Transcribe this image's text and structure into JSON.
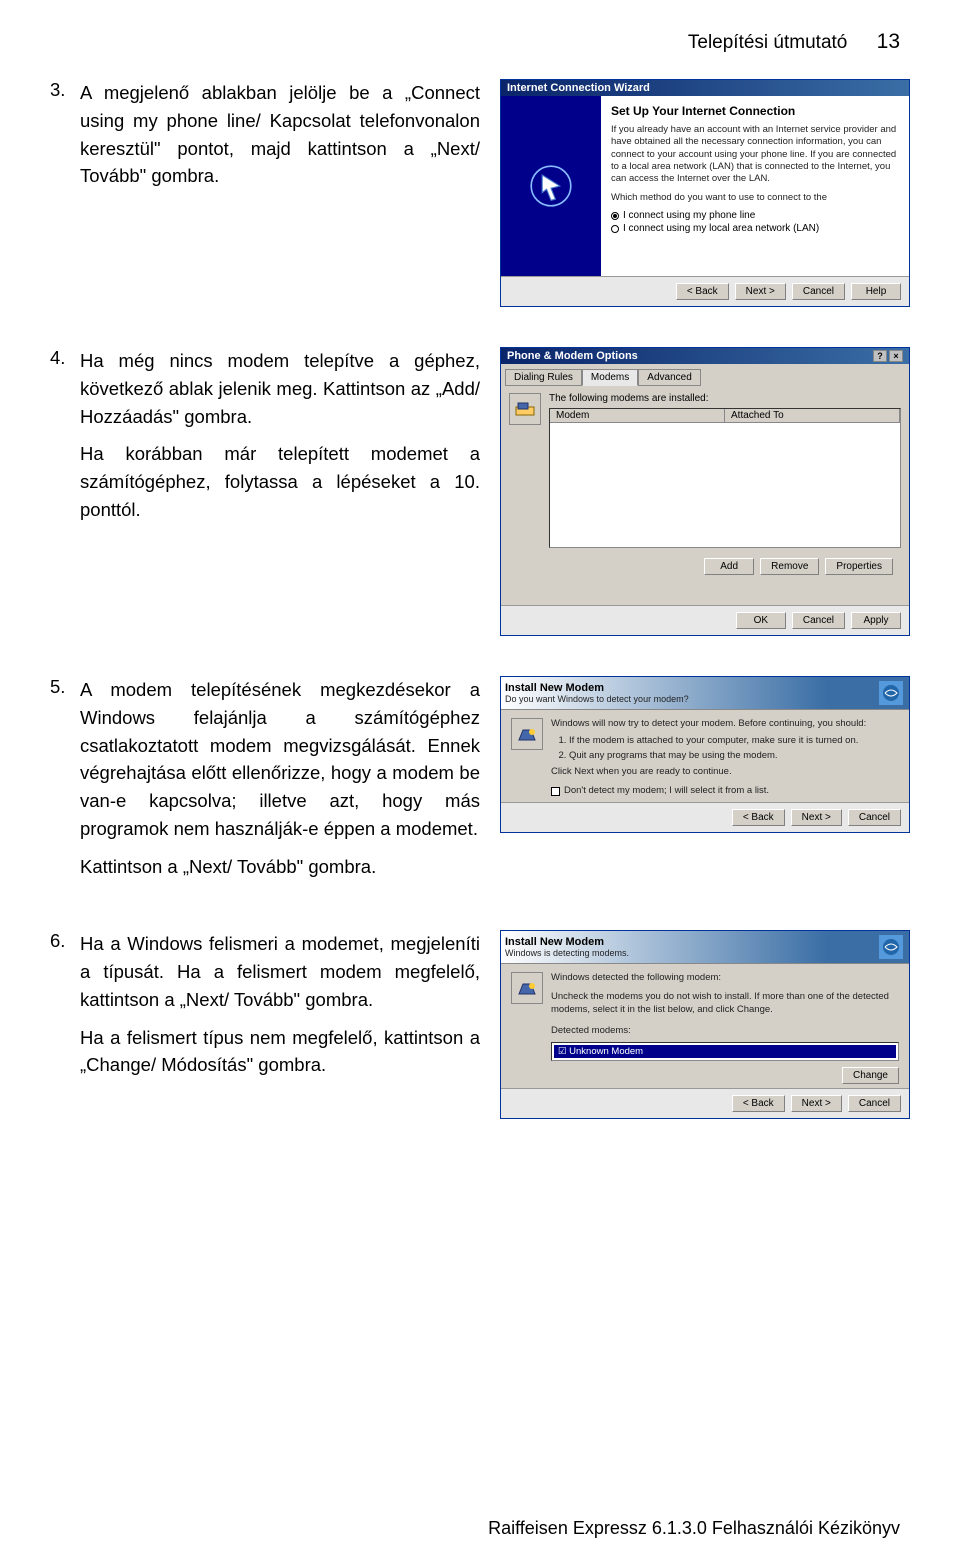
{
  "header": {
    "title": "Telepítési útmutató",
    "page": "13"
  },
  "steps": {
    "s3": {
      "num": "3.",
      "text": "A megjelenő ablakban jelölje be a „Connect using my phone line/ Kapcsolat telefonvonalon keresztül\" pontot, majd kattintson a „Next/ Tovább\" gombra."
    },
    "s4": {
      "num": "4.",
      "text": "Ha még nincs modem telepítve a géphez, következő ablak jelenik meg. Kattintson az „Add/ Hozzáadás\" gombra.",
      "sub": "Ha korábban már telepített modemet a számítógéphez, folytassa a lépéseket a 10. ponttól."
    },
    "s5": {
      "num": "5.",
      "text": "A modem telepítésének megkezdésekor a Windows felajánlja a számítógéphez csatlakoztatott modem megvizsgálását. Ennek végrehajtása előtt ellenőrizze, hogy a modem be van-e kapcsolva; illetve azt, hogy más programok nem használják-e éppen a modemet.",
      "sub": "Kattintson a „Next/ Tovább\" gombra."
    },
    "s6": {
      "num": "6.",
      "text": "Ha a Windows felismeri a modemet, megjeleníti a típusát. Ha a felismert modem megfelelő, kattintson a „Next/ Tovább\" gombra.",
      "sub": "Ha a felismert típus nem megfelelő, kattintson a „Change/ Módosítás\" gombra."
    }
  },
  "win1": {
    "title": "Internet Connection Wizard",
    "heading": "Set Up Your Internet Connection",
    "body": "If you already have an account with an Internet service provider and have obtained all the necessary connection information, you can connect to your account using your phone line. If you are connected to a local area network (LAN) that is connected to the Internet, you can access the Internet over the LAN.",
    "question": "Which method do you want to use to connect to the",
    "opt1": "I connect using my phone line",
    "opt2": "I connect using my local area network (LAN)",
    "back": "< Back",
    "next": "Next >",
    "cancel": "Cancel",
    "help": "Help"
  },
  "win2": {
    "title": "Phone & Modem Options",
    "tab1": "Dialing Rules",
    "tab2": "Modems",
    "tab3": "Advanced",
    "label": "The following modems are installed:",
    "col1": "Modem",
    "col2": "Attached To",
    "add": "Add",
    "remove": "Remove",
    "props": "Properties",
    "ok": "OK",
    "cancel": "Cancel",
    "apply": "Apply",
    "q": "?",
    "x": "×"
  },
  "win3": {
    "title": "Install New Modem",
    "sub": "Do you want Windows to detect your modem?",
    "body": "Windows will now try to detect your modem. Before continuing, you should:",
    "li1": "If the modem is attached to your computer, make sure it is turned on.",
    "li2": "Quit any programs that may be using the modem.",
    "body2": "Click Next when you are ready to continue.",
    "chk": "Don't detect my modem; I will select it from a list.",
    "back": "< Back",
    "next": "Next >",
    "cancel": "Cancel"
  },
  "win4": {
    "title": "Install New Modem",
    "sub": "Windows is detecting modems.",
    "body": "Windows detected the following modem:",
    "body2": "Uncheck the modems you do not wish to install. If more than one of the detected modems, select it in the list below, and click Change.",
    "label": "Detected modems:",
    "item": "☑ Unknown Modem",
    "change": "Change",
    "back": "< Back",
    "next": "Next >",
    "cancel": "Cancel"
  },
  "footer": "Raiffeisen Expressz 6.1.3.0 Felhasználói Kézikönyv"
}
